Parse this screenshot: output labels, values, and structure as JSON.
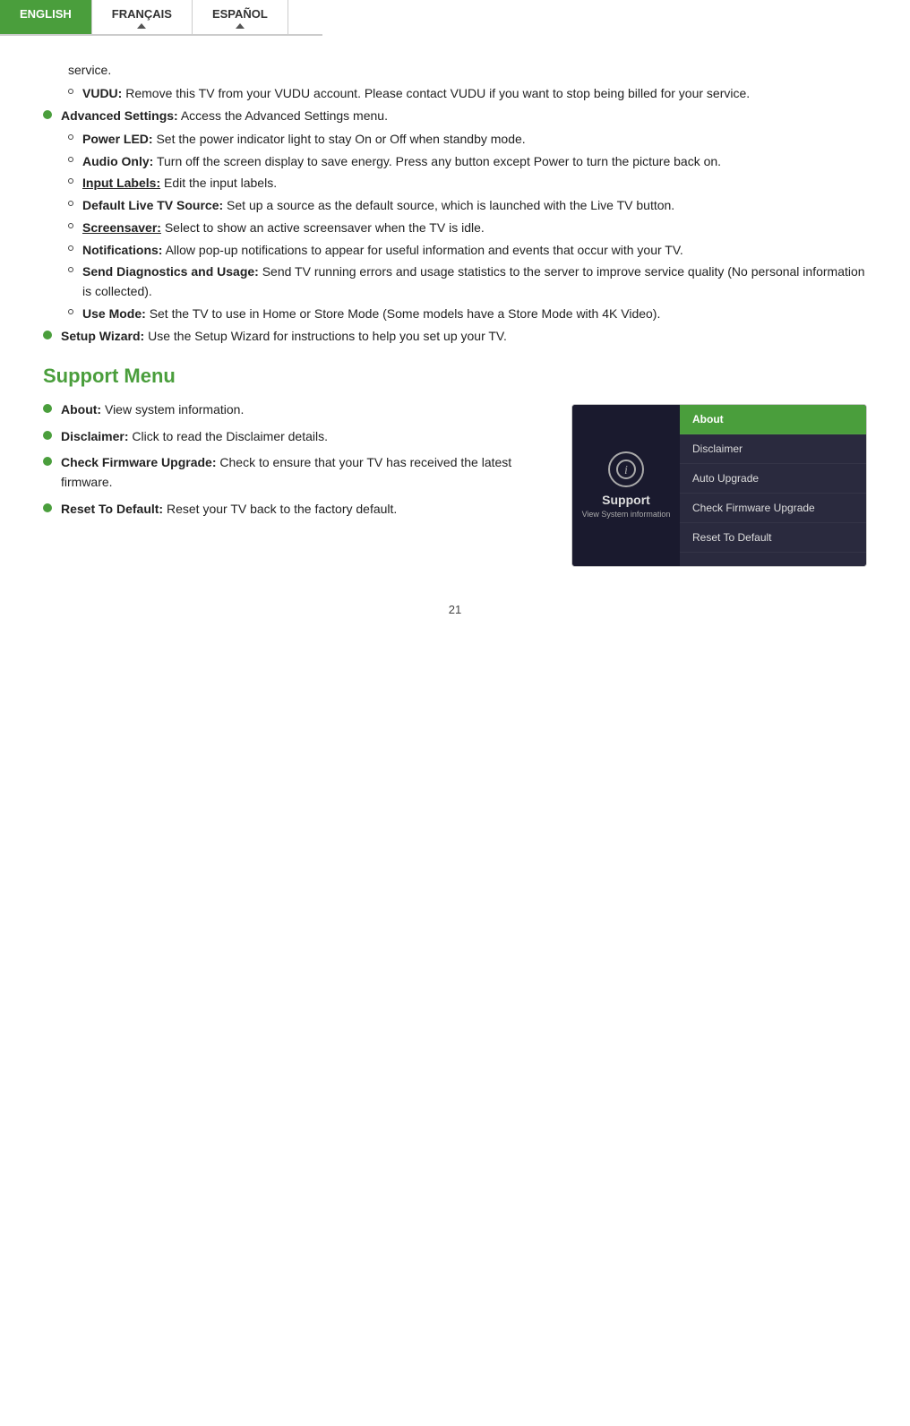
{
  "lang_tabs": [
    {
      "label": "ENGLISH",
      "active": true
    },
    {
      "label": "FRANÇAIS",
      "active": false,
      "has_triangle": true
    },
    {
      "label": "ESPAÑOL",
      "active": false,
      "has_triangle": true
    }
  ],
  "content": {
    "vudu_service_text": "service.",
    "vudu_text": "VUDU: Remove this TV from your VUDU account. Please contact VUDU if you want to stop being billed for your service.",
    "advanced_settings_label": "Advanced Settings:",
    "advanced_settings_text": "Access the Advanced Settings menu.",
    "power_led_label": "Power LED:",
    "power_led_text": "Set the power indicator light to stay On or Off when standby mode.",
    "audio_only_label": "Audio Only:",
    "audio_only_text": "Turn off the screen display to save energy. Press any button except Power to turn the picture back on.",
    "input_labels_label": "Input Labels:",
    "input_labels_text": "Edit the input labels.",
    "default_live_label": "Default Live TV Source:",
    "default_live_text": "Set up a source as the default source, which is launched with the Live TV button.",
    "screensaver_label": "Screensaver:",
    "screensaver_text": "Select to show an active screensaver when the TV is idle.",
    "notifications_label": "Notifications:",
    "notifications_text": "Allow pop-up notifications to appear for useful information and events that occur with your TV.",
    "send_diagnostics_label": "Send Diagnostics and Usage:",
    "send_diagnostics_text": "Send TV running errors and usage statistics to the server to improve service quality (No personal information is collected).",
    "use_mode_label": "Use Mode:",
    "use_mode_text": "Set the TV to use in Home or Store Mode (Some models have a Store Mode with 4K Video).",
    "setup_wizard_label": "Setup Wizard:",
    "setup_wizard_text": "Use the Setup Wizard for instructions to help you set up your TV.",
    "support_menu_heading": "Support Menu",
    "about_label": "About:",
    "about_text": "View system information.",
    "disclaimer_label": "Disclaimer:",
    "disclaimer_text": "Click to read the Disclaimer details.",
    "check_firmware_label": "Check Firmware Upgrade:",
    "check_firmware_text": "Check to ensure that your TV has received the latest firmware.",
    "reset_label": "Reset To Default:",
    "reset_text": "Reset your TV back to the factory default.",
    "tv_ui": {
      "support_label": "Support",
      "view_system_label": "View System information",
      "menu_items": [
        {
          "label": "About",
          "selected": true
        },
        {
          "label": "Disclaimer",
          "selected": false
        },
        {
          "label": "Auto Upgrade",
          "selected": false
        },
        {
          "label": "Check Firmware Upgrade",
          "selected": false
        },
        {
          "label": "Reset To Default",
          "selected": false
        }
      ]
    },
    "page_number": "21"
  }
}
